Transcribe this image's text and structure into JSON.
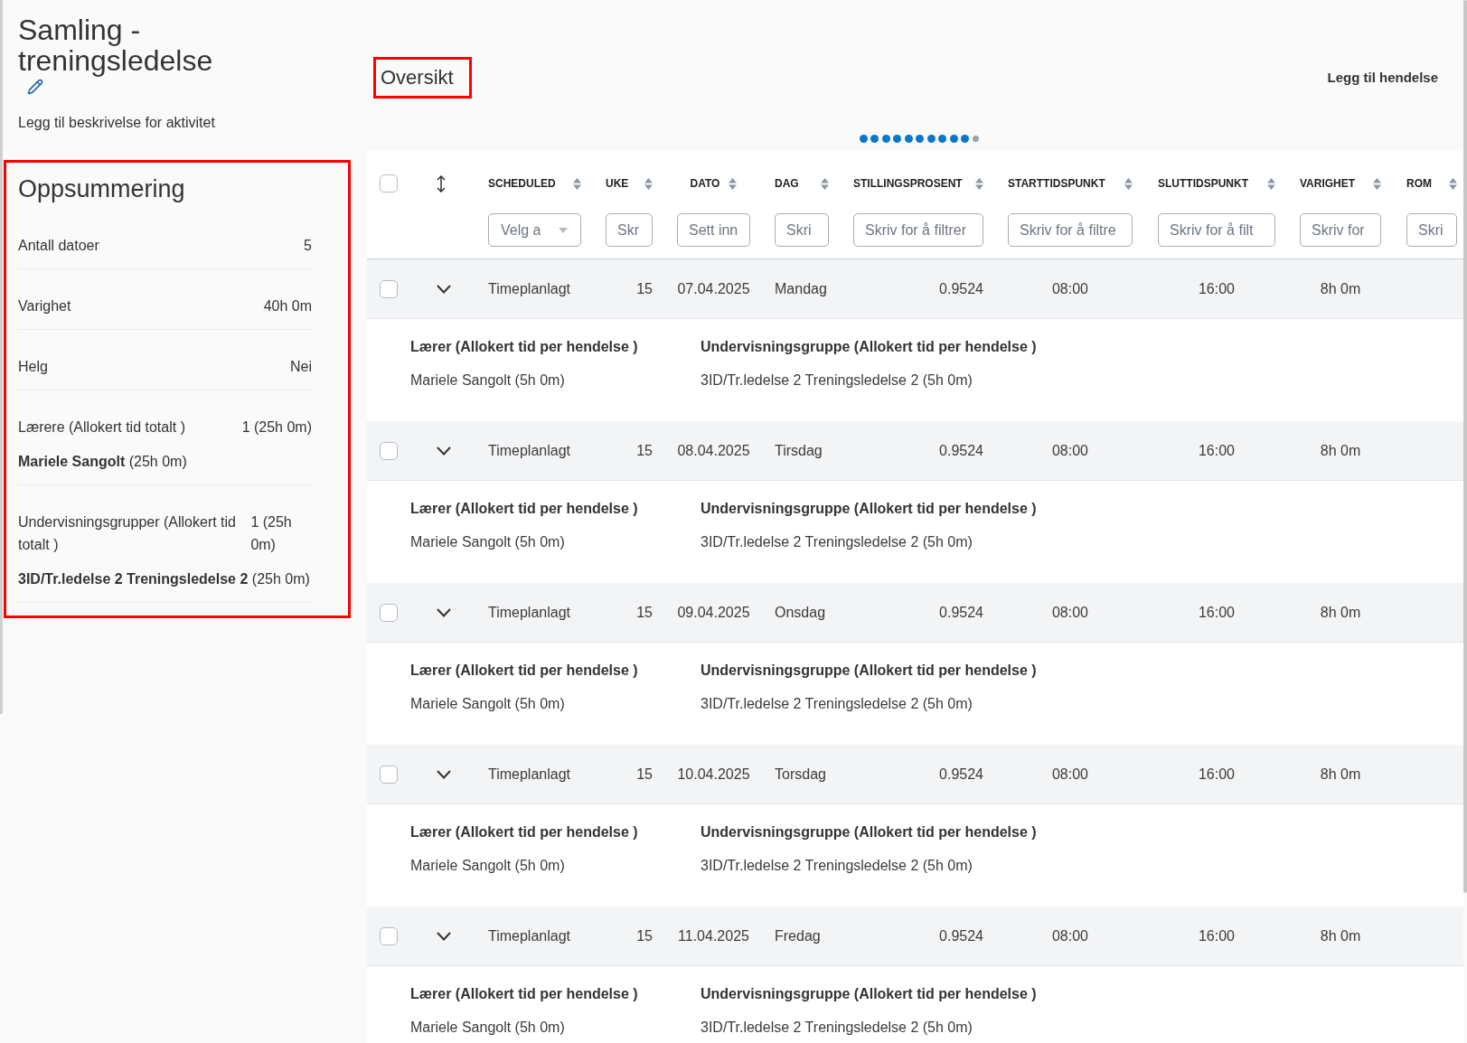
{
  "activity": {
    "title": "Samling - treningsledelse",
    "description_prompt": "Legg til beskrivelse for aktivitet"
  },
  "summary": {
    "title": "Oppsummering",
    "highlighted": true,
    "rows": [
      {
        "label": "Antall datoer",
        "value": "5"
      },
      {
        "label": "Varighet",
        "value": "40h 0m"
      },
      {
        "label": "Helg",
        "value": "Nei"
      },
      {
        "label": "Lærere (Allokert tid totalt )",
        "value": "1 (25h 0m)",
        "items": [
          "**Mariele Sangolt** (25h 0m)"
        ]
      },
      {
        "label": "Undervisningsgrupper (Allokert tid totalt )",
        "value": "1 (25h 0m)",
        "items": [
          "**3ID/Tr.ledelse 2 Treningsledelse 2** (25h 0m)"
        ]
      }
    ]
  },
  "overview": {
    "title": "Oversikt",
    "highlighted": true,
    "add_button": "Legg til hendelse"
  },
  "page_dots": [
    {
      "active": true
    },
    {
      "active": true
    },
    {
      "active": true
    },
    {
      "active": true
    },
    {
      "active": true
    },
    {
      "active": true
    },
    {
      "active": true
    },
    {
      "active": true
    },
    {
      "active": true
    },
    {
      "active": true
    },
    {
      "active": false
    }
  ],
  "table": {
    "select_all": {
      "checked": false
    },
    "columns": [
      {
        "label": "SCHEDULED",
        "filter": {
          "kind": "select",
          "placeholder": "Velg a"
        }
      },
      {
        "label": "UKE",
        "filter": {
          "kind": "text",
          "placeholder": "Skr"
        }
      },
      {
        "label": "DATO",
        "filter": {
          "kind": "text",
          "placeholder": "Sett inn"
        }
      },
      {
        "label": "DAG",
        "filter": {
          "kind": "text",
          "placeholder": "Skri"
        }
      },
      {
        "label": "STILLINGSPROSENT",
        "filter": {
          "kind": "text",
          "placeholder": "Skriv for å filtrer"
        }
      },
      {
        "label": "STARTTIDSPUNKT",
        "filter": {
          "kind": "text",
          "placeholder": "Skriv for å filtre"
        }
      },
      {
        "label": "SLUTTIDSPUNKT",
        "filter": {
          "kind": "text",
          "placeholder": "Skriv for å filt"
        }
      },
      {
        "label": "VARIGHET",
        "filter": {
          "kind": "text",
          "placeholder": "Skriv for"
        }
      },
      {
        "label": "ROM",
        "filter": {
          "kind": "text",
          "placeholder": "Skri"
        }
      }
    ],
    "rows": [
      {
        "checked": false,
        "expanded": true,
        "cells": [
          "Timeplanlagt",
          "15",
          "07.04.2025",
          "Mandag",
          "0.9524",
          "08:00",
          "16:00",
          "8h 0m"
        ],
        "details": [
          {
            "label": "Lærer (Allokert tid per hendelse )",
            "value": "Mariele Sangolt (5h 0m)"
          },
          {
            "label": "Undervisningsgruppe (Allokert tid per hendelse )",
            "value": "3ID/Tr.ledelse 2 Treningsledelse 2 (5h 0m)"
          }
        ]
      },
      {
        "checked": false,
        "expanded": true,
        "cells": [
          "Timeplanlagt",
          "15",
          "08.04.2025",
          "Tirsdag",
          "0.9524",
          "08:00",
          "16:00",
          "8h 0m"
        ],
        "details": [
          {
            "label": "Lærer (Allokert tid per hendelse )",
            "value": "Mariele Sangolt (5h 0m)"
          },
          {
            "label": "Undervisningsgruppe (Allokert tid per hendelse )",
            "value": "3ID/Tr.ledelse 2 Treningsledelse 2 (5h 0m)"
          }
        ]
      },
      {
        "checked": false,
        "expanded": true,
        "cells": [
          "Timeplanlagt",
          "15",
          "09.04.2025",
          "Onsdag",
          "0.9524",
          "08:00",
          "16:00",
          "8h 0m"
        ],
        "details": [
          {
            "label": "Lærer (Allokert tid per hendelse )",
            "value": "Mariele Sangolt (5h 0m)"
          },
          {
            "label": "Undervisningsgruppe (Allokert tid per hendelse )",
            "value": "3ID/Tr.ledelse 2 Treningsledelse 2 (5h 0m)"
          }
        ]
      },
      {
        "checked": false,
        "expanded": true,
        "cells": [
          "Timeplanlagt",
          "15",
          "10.04.2025",
          "Torsdag",
          "0.9524",
          "08:00",
          "16:00",
          "8h 0m"
        ],
        "details": [
          {
            "label": "Lærer (Allokert tid per hendelse )",
            "value": "Mariele Sangolt (5h 0m)"
          },
          {
            "label": "Undervisningsgruppe (Allokert tid per hendelse )",
            "value": "3ID/Tr.ledelse 2 Treningsledelse 2 (5h 0m)"
          }
        ]
      },
      {
        "checked": false,
        "expanded": true,
        "cells": [
          "Timeplanlagt",
          "15",
          "11.04.2025",
          "Fredag",
          "0.9524",
          "08:00",
          "16:00",
          "8h 0m"
        ],
        "details": [
          {
            "label": "Lærer (Allokert tid per hendelse )",
            "value": "Mariele Sangolt (5h 0m)"
          },
          {
            "label": "Undervisningsgruppe (Allokert tid per hendelse )",
            "value": "3ID/Tr.ledelse 2 Treningsledelse 2 (5h 0m)"
          }
        ]
      }
    ]
  }
}
